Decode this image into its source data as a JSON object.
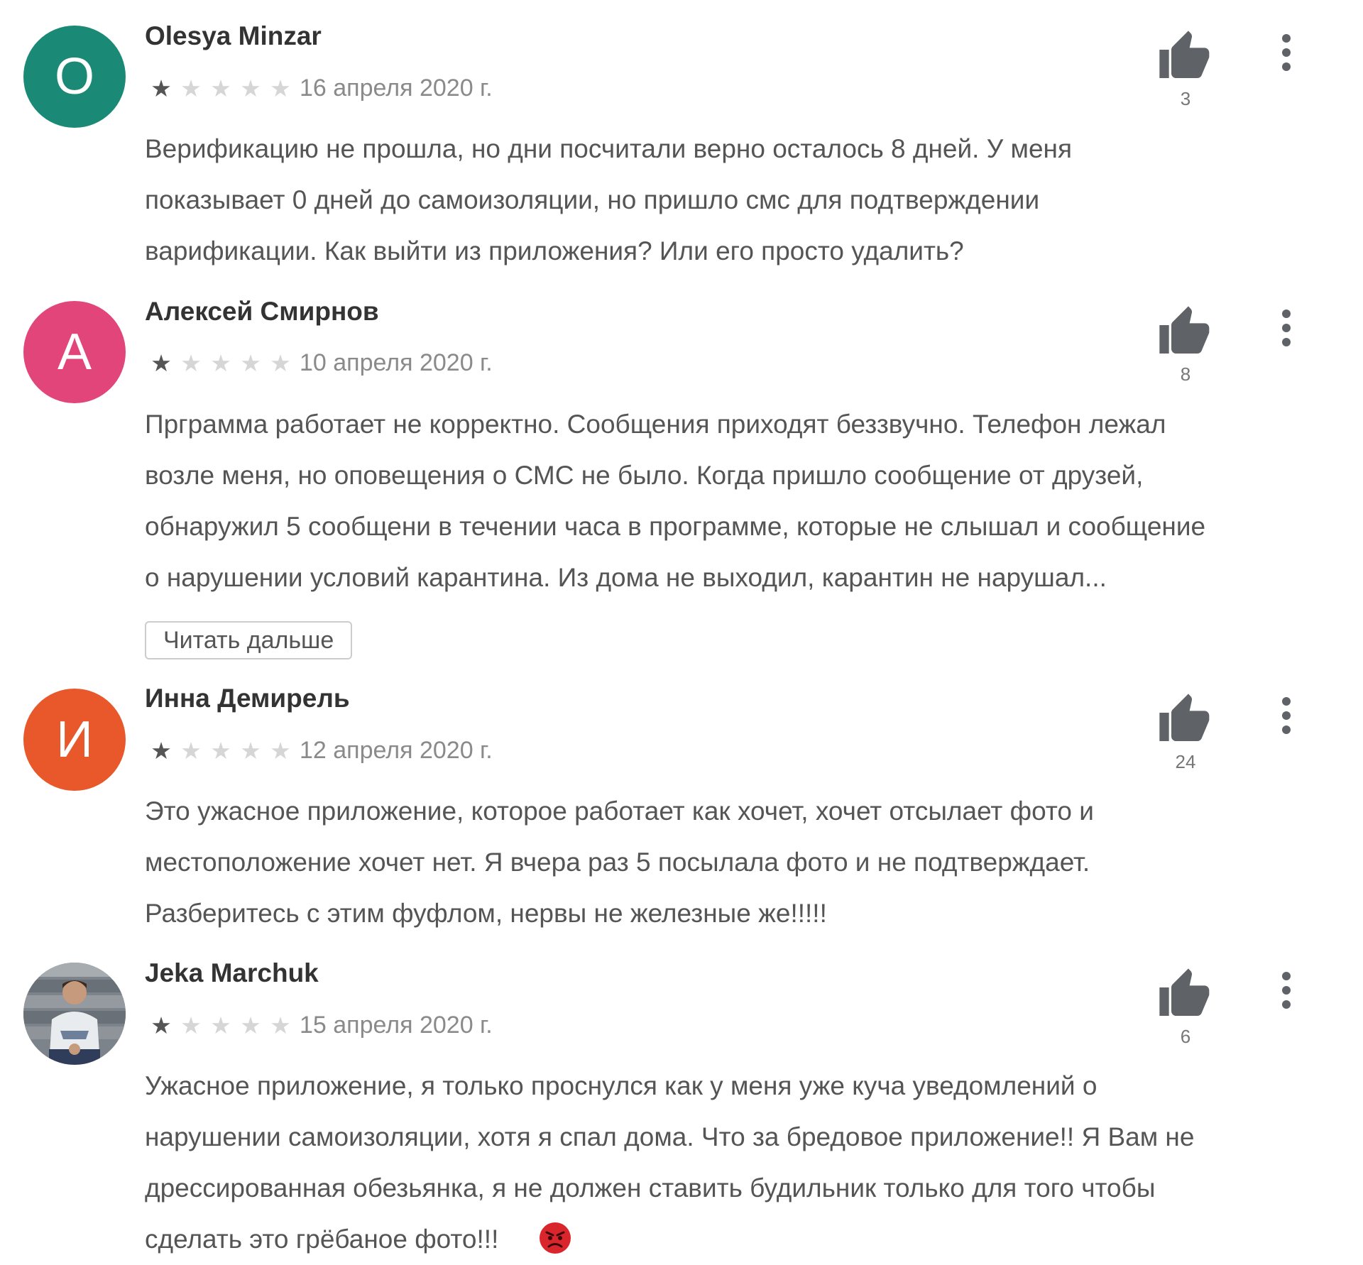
{
  "reviews": [
    {
      "avatar_letter": "O",
      "avatar_color": "#1a8a76",
      "author": "Olesya Minzar",
      "rating": 1,
      "date": "16 апреля 2020 г.",
      "likes": "3",
      "text": "Верификацию не прошла, но дни посчитали верно осталось 8 дней. У меня\nпоказывает 0 дней до самоизоляции, но пришло смс для подтверждении\nварификации. Как выйти из приложения? Или его просто удалить?"
    },
    {
      "avatar_letter": "А",
      "avatar_color": "#e2457a",
      "author": "Алексей Смирнов",
      "rating": 1,
      "date": "10 апреля 2020 г.",
      "likes": "8",
      "text": "Прграмма работает не корректно. Сообщения приходят беззвучно. Телефон лежал\nвозле меня, но оповещения о СМС не было. Когда пришло сообщение от друзей,\nобнаружил 5 сообщени в течении часа в программе, которые не слышал и сообщение\nо нарушении условий карантина. Из дома не выходил, карантин не нарушал...",
      "read_more": "Читать дальше"
    },
    {
      "avatar_letter": "И",
      "avatar_color": "#e8582a",
      "author": "Инна Демирель",
      "rating": 1,
      "date": "12 апреля 2020 г.",
      "likes": "24",
      "text": "Это ужасное приложение, которое работает как хочет, хочет отсылает фото и\nместоположение хочет нет. Я вчера раз 5 посылала фото и не подтверждает.\nРазберитесь с этим фуфлом, нервы не железные же!!!!!"
    },
    {
      "avatar_letter": "",
      "avatar_color": "#8a9098",
      "author": "Jeka Marchuk",
      "rating": 1,
      "date": "15 апреля 2020 г.",
      "likes": "6",
      "text": "Ужасное приложение, я только проснулся как у меня уже куча уведомлений о\nнарушении самоизоляции, хотя я спал дома. Что за бредовое приложение!! Я Вам не\nдрессированная обезьянка, я не должен ставить будильник только для того чтобы\nсделать это грёбаное фото!!!"
    }
  ],
  "colors": {
    "star_on": "#555555",
    "star_off": "#d6d6d6",
    "icon": "#5f6368"
  },
  "icons": {
    "like": "thumbs-up-icon",
    "menu": "more-vertical-icon",
    "emoji": "angry-face-icon"
  }
}
